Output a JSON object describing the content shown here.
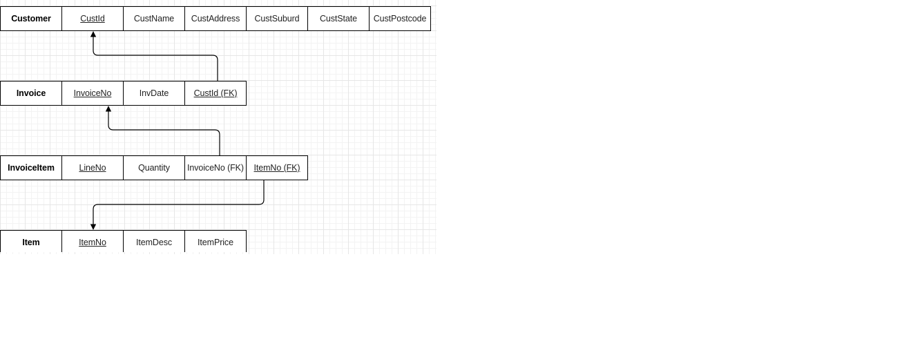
{
  "tables": [
    {
      "entity": "Customer",
      "attributes": [
        {
          "name": "CustId",
          "key": true
        },
        {
          "name": "CustName",
          "key": false
        },
        {
          "name": "CustAddress",
          "key": false
        },
        {
          "name": "CustSuburd",
          "key": false
        },
        {
          "name": "CustState",
          "key": false
        },
        {
          "name": "CustPostcode",
          "key": false
        }
      ]
    },
    {
      "entity": "Invoice",
      "attributes": [
        {
          "name": "InvoiceNo",
          "key": true
        },
        {
          "name": "InvDate",
          "key": false
        },
        {
          "name": "CustId (FK)",
          "key": true
        }
      ]
    },
    {
      "entity": "InvoiceItem",
      "attributes": [
        {
          "name": "LineNo",
          "key": true
        },
        {
          "name": "Quantity",
          "key": false
        },
        {
          "name": "InvoiceNo (FK)",
          "key": false
        },
        {
          "name": "ItemNo (FK)",
          "key": true
        }
      ]
    },
    {
      "entity": "Item",
      "attributes": [
        {
          "name": "ItemNo",
          "key": true
        },
        {
          "name": "ItemDesc",
          "key": false
        },
        {
          "name": "ItemPrice",
          "key": false
        }
      ]
    }
  ],
  "relationships": [
    {
      "from": "Invoice.CustId (FK)",
      "to": "Customer.CustId"
    },
    {
      "from": "InvoiceItem.InvoiceNo (FK)",
      "to": "Invoice.InvoiceNo"
    },
    {
      "from": "InvoiceItem.ItemNo (FK)",
      "to": "Item.ItemNo"
    }
  ],
  "colors": {
    "border": "#000000",
    "grid": "#e6e6e6",
    "text": "#222222"
  }
}
